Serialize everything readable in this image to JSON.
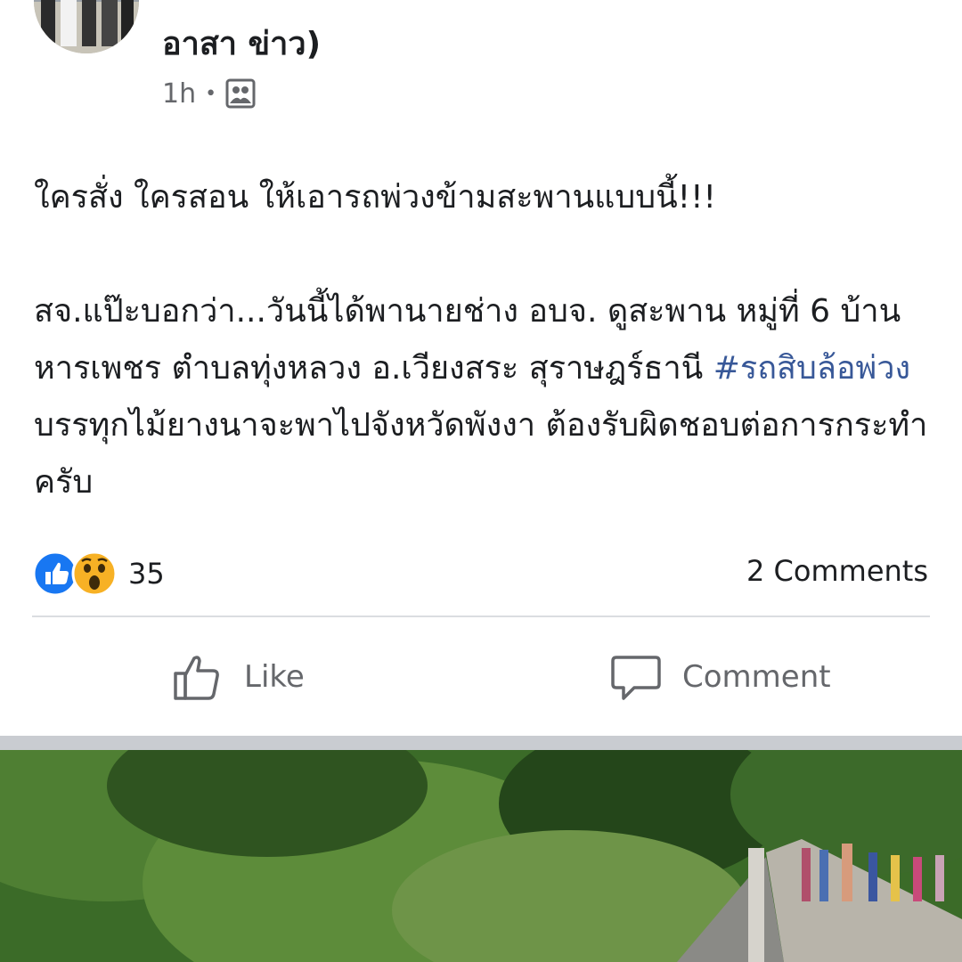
{
  "post": {
    "author": "อาสา ข่าว)",
    "time": "1h",
    "separator_dot": "•",
    "privacy_icon": "group-icon",
    "text": {
      "line1": "ใครสั่ง ใครสอน ให้เอารถพ่วงข้ามสะพานแบบนี้!!!",
      "para2_before": "สจ.แป๊ะบอกว่า...วันนี้ได้พานายช่าง อบจ. ดูสะพาน หมู่ที่ 6 บ้านหารเพชร ตำบลทุ่งหลวง อ.เวียงสระ สุราษฎร์ธานี ",
      "hashtag": "#รถสิบล้อพ่วง",
      "para2_after": "บรรทุกไม้ยางนาจะพาไปจังหวัดพังงา ต้องรับผิดชอบต่อการกระทำครับ"
    },
    "reactions": {
      "icons": [
        "like-reaction-icon",
        "wow-reaction-icon"
      ],
      "count": "35"
    },
    "comments_count": "2 Comments",
    "actions": {
      "like": "Like",
      "comment": "Comment"
    }
  },
  "colors": {
    "hashtag": "#385898",
    "like_blue": "#1877f2",
    "wow_yellow": "#f7b125",
    "secondary_text": "#65676b"
  }
}
